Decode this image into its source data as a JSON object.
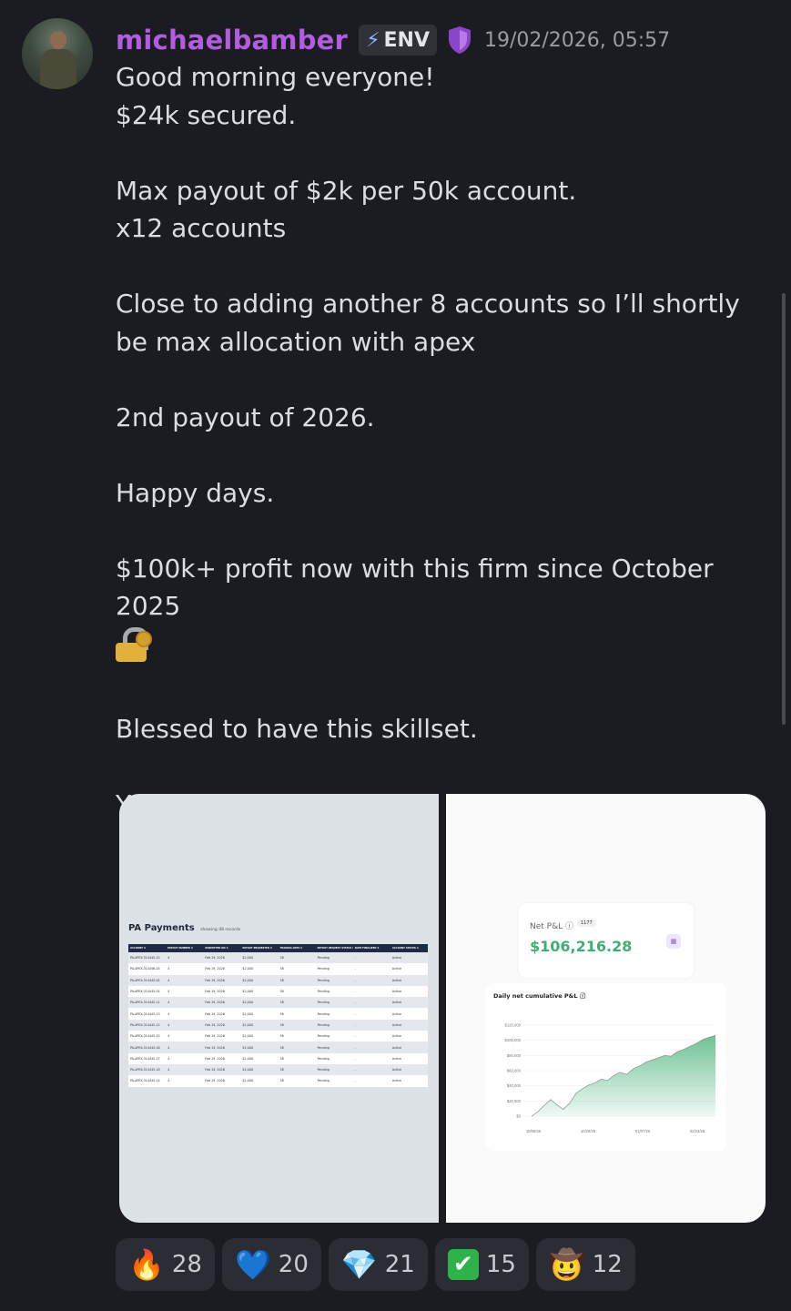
{
  "post": {
    "username": "michaelbamber",
    "tag": "ENV",
    "timestamp": "19/02/2026, 05:57",
    "lines": [
      "Good morning everyone!",
      "$24k secured.",
      "",
      "Max payout of $2k per 50k account.",
      "x12 accounts",
      "",
      "Close to adding another 8 accounts so I’ll shortly be max allocation with apex",
      "",
      "2nd payout of 2026.",
      "",
      "Happy days.",
      "",
      "$100k+ profit now with this firm since October 2025",
      "",
      "Blessed to have this skillset.",
      "",
      "You all can do the same."
    ]
  },
  "attachments": {
    "payments": {
      "title": "PA Payments",
      "subtitle": "showing 48 records",
      "headers": [
        "ACCOUNT",
        "PAYOUT NUMBER",
        "SUBMITTED ON",
        "PAYOUT REQUESTED",
        "TRADING DAYS",
        "PAYOUT REQUEST STATUS",
        "DATE FINALIZED",
        "ACCOUNT STATUS"
      ],
      "rows": [
        [
          "PA-APEX-314445-15",
          "4",
          "Feb 19, 2026",
          "$2,000",
          "38",
          "Pending",
          "-",
          "Active"
        ],
        [
          "PA-APEX-314456-03",
          "4",
          "Feb 19, 2026",
          "$2,000",
          "38",
          "Pending",
          "-",
          "Active"
        ],
        [
          "PA-APEX-314445-02",
          "4",
          "Feb 19, 2026",
          "$2,000",
          "38",
          "Pending",
          "-",
          "Active"
        ],
        [
          "PA-APEX-314445-01",
          "4",
          "Feb 19, 2026",
          "$2,000",
          "38",
          "Pending",
          "-",
          "Active"
        ],
        [
          "PA-APEX-314445-11",
          "4",
          "Feb 19, 2026",
          "$2,000",
          "38",
          "Pending",
          "-",
          "Active"
        ],
        [
          "PA-APEX-314445-13",
          "4",
          "Feb 19, 2026",
          "$2,000",
          "38",
          "Pending",
          "-",
          "Active"
        ],
        [
          "PA-APEX-314445-12",
          "4",
          "Feb 19, 2026",
          "$2,000",
          "38",
          "Pending",
          "-",
          "Active"
        ],
        [
          "PA-APEX-314445-15",
          "4",
          "Feb 19, 2026",
          "$2,000",
          "38",
          "Pending",
          "-",
          "Active"
        ],
        [
          "PA-APEX-314445-16",
          "4",
          "Feb 19, 2026",
          "$2,000",
          "38",
          "Pending",
          "-",
          "Active"
        ],
        [
          "PA-APEX-314445-17",
          "4",
          "Feb 19, 2026",
          "$2,000",
          "38",
          "Pending",
          "-",
          "Active"
        ],
        [
          "PA-APEX-314445-18",
          "4",
          "Feb 19, 2026",
          "$2,000",
          "38",
          "Pending",
          "-",
          "Active"
        ],
        [
          "PA-APEX-314445-14",
          "4",
          "Feb 19, 2026",
          "$2,000",
          "38",
          "Pending",
          "-",
          "Active"
        ]
      ]
    },
    "pnl": {
      "label": "Net P&L",
      "badge": "1177",
      "value": "$106,216.28",
      "chart_title": "Daily net cumulative P&L"
    }
  },
  "chart_data": {
    "type": "area",
    "title": "Daily net cumulative P&L",
    "xlabel": "",
    "ylabel": "",
    "x_ticks": [
      "10/08/25",
      "10/29/25",
      "01/07/26",
      "02/03/26"
    ],
    "y_ticks": [
      "$120,000",
      "$100,000",
      "$80,000",
      "$60,000",
      "$40,000",
      "$20,000",
      "$0"
    ],
    "ylim": [
      0,
      120000
    ],
    "values": [
      0,
      6000,
      14000,
      22000,
      15000,
      9000,
      17000,
      30000,
      36000,
      41000,
      44000,
      49000,
      47000,
      54000,
      58000,
      55000,
      62000,
      66000,
      71000,
      74000,
      77000,
      80000,
      79000,
      85000,
      88000,
      92000,
      96000,
      101000,
      104000,
      106216
    ],
    "color": "#3fae72"
  },
  "reactions": [
    {
      "emoji": "🔥",
      "count": "28"
    },
    {
      "emoji": "💙",
      "count": "20"
    },
    {
      "emoji": "💎",
      "count": "21"
    },
    {
      "emoji": "✔",
      "count": "15"
    },
    {
      "emoji": "🤠",
      "count": "12"
    }
  ]
}
